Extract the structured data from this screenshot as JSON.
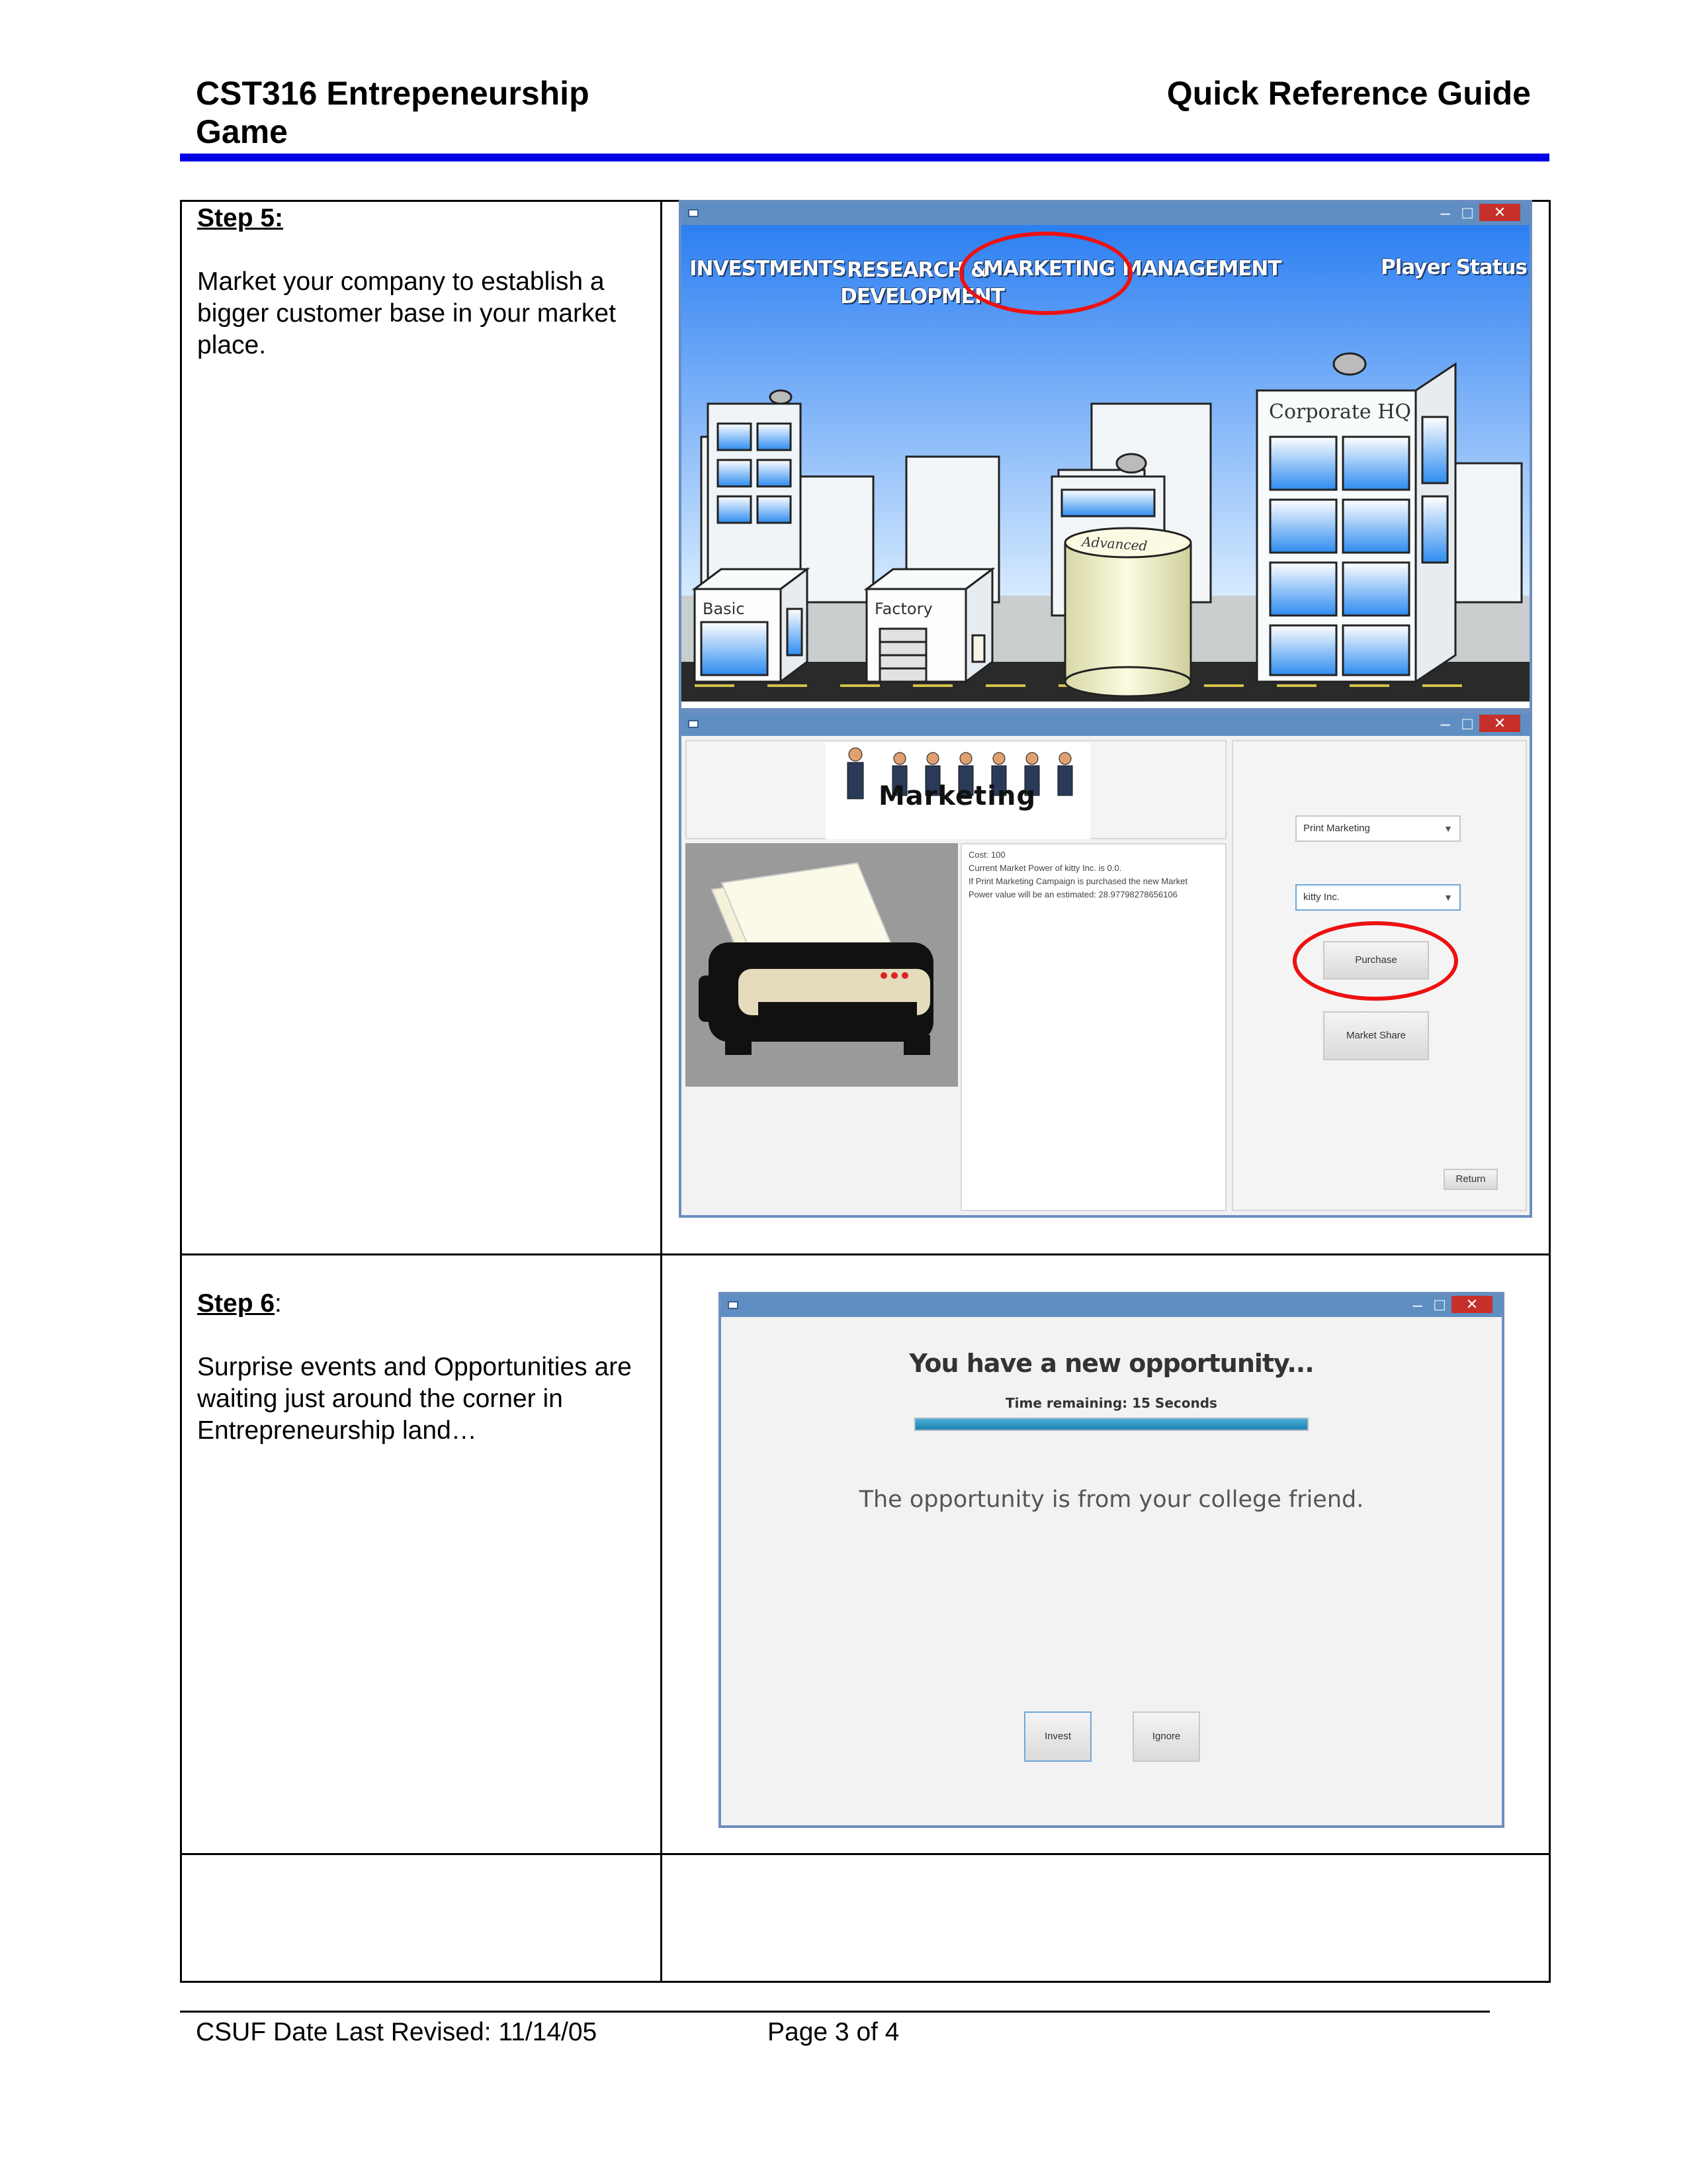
{
  "header": {
    "title_line1": "CST316 Entrepeneurship",
    "title_line2": "Game",
    "right_title": "Quick Reference Guide"
  },
  "steps": [
    {
      "label": "Step 5:",
      "text": "Market your company to establish a bigger customer base in your market place."
    },
    {
      "label": "Step 6",
      "label_suffix": ":",
      "text": "Surprise events and Opportunities are waiting just around the corner in Entrepreneurship land…"
    }
  ],
  "city_window": {
    "nav": {
      "investments": "INVESTMENTS",
      "research_line1": "RESEARCH &",
      "research_line2": "DEVELOPMENT",
      "marketing": "MARKETING",
      "management": "MANAGEMENT",
      "player_status": "Player Status"
    },
    "buildings": {
      "basic": "Basic",
      "factory": "Factory",
      "advanced": "Advanced",
      "hq": "Corporate HQ"
    }
  },
  "marketing_window": {
    "banner": "Marketing",
    "info_lines": [
      "Cost: 100",
      "Current Market Power of kitty Inc. is 0.0.",
      "If Print Marketing Campaign is purchased the new Market",
      "Power value will be an estimated: 28.97798278656106"
    ],
    "campaign_select": "Print Marketing",
    "company_select": "kitty Inc.",
    "purchase_button": "Purchase",
    "market_share_button": "Market Share",
    "return_button": "Return"
  },
  "opportunity_window": {
    "heading": "You have a new opportunity...",
    "timer_label": "Time remaining:",
    "timer_value": "15 Seconds",
    "message": "The opportunity is from your college friend.",
    "invest_button": "Invest",
    "ignore_button": "Ignore"
  },
  "titlebar": {
    "min": "–",
    "max": "□",
    "close": "✕"
  },
  "footer": {
    "left": "CSUF Date Last Revised: 11/14/05",
    "right": "Page 3 of 4"
  },
  "colors": {
    "accent_rule": "#0000e6",
    "highlight": "#e11111",
    "titlebar": "#5f8ec2"
  }
}
